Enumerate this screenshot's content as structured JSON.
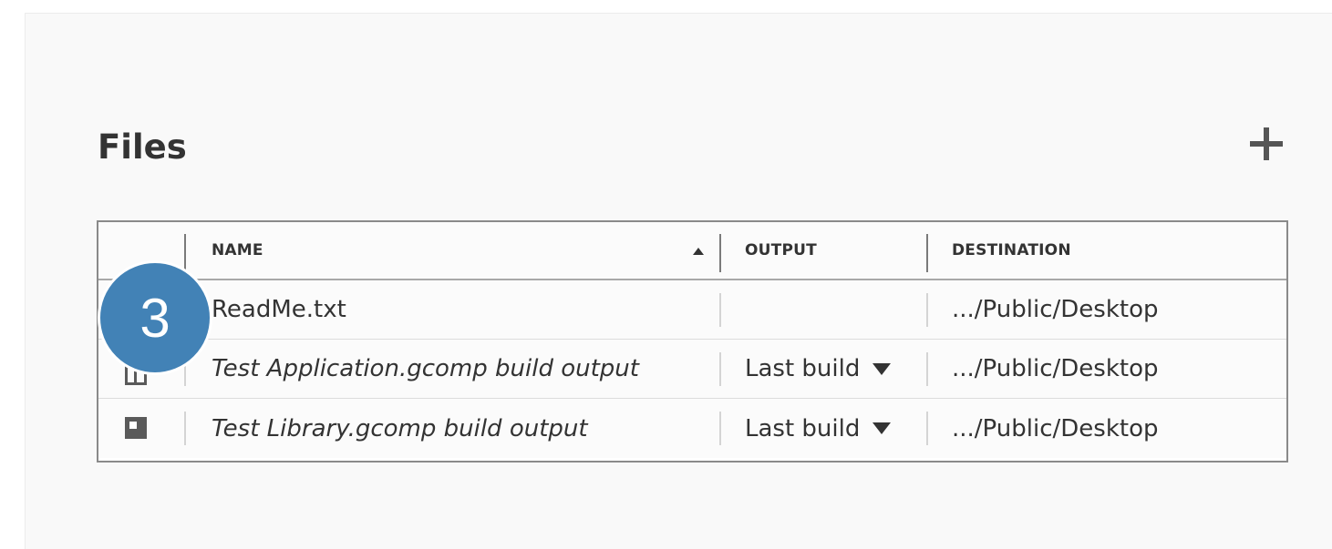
{
  "section": {
    "title": "Files",
    "add_icon": "plus-icon"
  },
  "table": {
    "columns": [
      {
        "label": "",
        "key": "type"
      },
      {
        "label": "NAME",
        "key": "name",
        "sort": "ascending"
      },
      {
        "label": "OUTPUT",
        "key": "output"
      },
      {
        "label": "DESTINATION",
        "key": "destination"
      }
    ],
    "rows": [
      {
        "icon": "text-file-icon",
        "name": "ReadMe.txt",
        "output": "",
        "destination": ".../Public/Desktop"
      },
      {
        "icon": "application-icon",
        "name": "Test Application.gcomp build output",
        "output": "Last build",
        "destination": ".../Public/Desktop"
      },
      {
        "icon": "library-icon",
        "name": "Test Library.gcomp build output",
        "output": "Last build",
        "destination": ".../Public/Desktop"
      }
    ]
  },
  "callout": {
    "number": "3",
    "color": "#4282b6"
  },
  "colors": {
    "panel_background": "#f9f9f9",
    "text": "#333333",
    "icon": "#5a5a5a",
    "table_border": "#8a8a8a"
  }
}
